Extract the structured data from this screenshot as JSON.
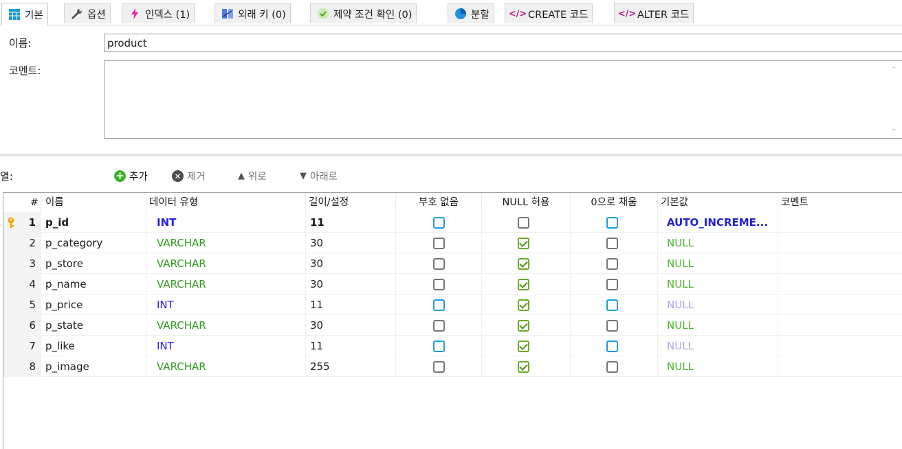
{
  "tabs": [
    {
      "label": "기본",
      "icon": "table-icon",
      "active": true
    },
    {
      "label": "옵션",
      "icon": "wrench-icon"
    },
    {
      "label": "인덱스 (1)",
      "icon": "lightning-icon"
    },
    {
      "label": "외래 키 (0)",
      "icon": "foreign-key-icon"
    },
    {
      "label": "제약 조건 확인 (0)",
      "icon": "check-circle-icon"
    },
    {
      "label": "분할",
      "icon": "pie-icon"
    },
    {
      "label": "CREATE 코드",
      "icon": "code-icon"
    },
    {
      "label": "ALTER 코드",
      "icon": "code-icon"
    }
  ],
  "form": {
    "name_label": "이름:",
    "name_value": "product",
    "comment_label": "코멘트:",
    "comment_value": ""
  },
  "columns_toolbar": {
    "label": "열:",
    "add": "추가",
    "remove": "제거",
    "up": "위로",
    "down": "아래로"
  },
  "grid": {
    "headers": [
      "#",
      "이름",
      "데이터 유형",
      "길이/설정",
      "부호 없음",
      "NULL 허용",
      "0으로 채움",
      "기본값",
      "코멘트"
    ],
    "rows": [
      {
        "num": "1",
        "name": "p_id",
        "type": "INT",
        "length": "11",
        "unsigned": false,
        "nullable": false,
        "zerofill": false,
        "default": "AUTO_INCREME...",
        "comment": "",
        "primary": true
      },
      {
        "num": "2",
        "name": "p_category",
        "type": "VARCHAR",
        "length": "30",
        "unsigned": false,
        "nullable": true,
        "zerofill": false,
        "default": "NULL",
        "comment": ""
      },
      {
        "num": "3",
        "name": "p_store",
        "type": "VARCHAR",
        "length": "30",
        "unsigned": false,
        "nullable": true,
        "zerofill": false,
        "default": "NULL",
        "comment": ""
      },
      {
        "num": "4",
        "name": "p_name",
        "type": "VARCHAR",
        "length": "30",
        "unsigned": false,
        "nullable": true,
        "zerofill": false,
        "default": "NULL",
        "comment": ""
      },
      {
        "num": "5",
        "name": "p_price",
        "type": "INT",
        "length": "11",
        "unsigned": false,
        "nullable": true,
        "zerofill": false,
        "default": "NULL",
        "comment": ""
      },
      {
        "num": "6",
        "name": "p_state",
        "type": "VARCHAR",
        "length": "30",
        "unsigned": false,
        "nullable": true,
        "zerofill": false,
        "default": "NULL",
        "comment": ""
      },
      {
        "num": "7",
        "name": "p_like",
        "type": "INT",
        "length": "11",
        "unsigned": false,
        "nullable": true,
        "zerofill": false,
        "default": "NULL",
        "comment": ""
      },
      {
        "num": "8",
        "name": "p_image",
        "type": "VARCHAR",
        "length": "255",
        "unsigned": false,
        "nullable": true,
        "zerofill": false,
        "default": "NULL",
        "comment": ""
      }
    ]
  },
  "colors": {
    "int_type": "#2222e0",
    "varchar_type": "#2f9a1e",
    "default_auto": "#2020d8",
    "null_green": "#4fb32e",
    "null_lavender": "#a7a7e8",
    "int_checkbox_border": "#1e9be0",
    "checked_border": "#6aaa28",
    "key_color": "#f0a800"
  }
}
